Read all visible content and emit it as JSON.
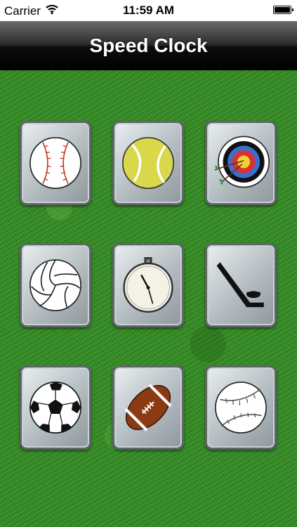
{
  "status_bar": {
    "carrier": "Carrier",
    "time": "11:59 AM"
  },
  "nav": {
    "title": "Speed Clock"
  },
  "sports": [
    {
      "icon": "baseball-icon"
    },
    {
      "icon": "tennis-ball-icon"
    },
    {
      "icon": "archery-target-icon"
    },
    {
      "icon": "volleyball-icon"
    },
    {
      "icon": "stopwatch-icon"
    },
    {
      "icon": "hockey-stick-puck-icon"
    },
    {
      "icon": "soccer-ball-icon"
    },
    {
      "icon": "football-icon"
    },
    {
      "icon": "softball-icon"
    }
  ],
  "colors": {
    "field_green": "#338c22",
    "nav_black": "#000000",
    "tile_silver": "#aeb8bd"
  }
}
